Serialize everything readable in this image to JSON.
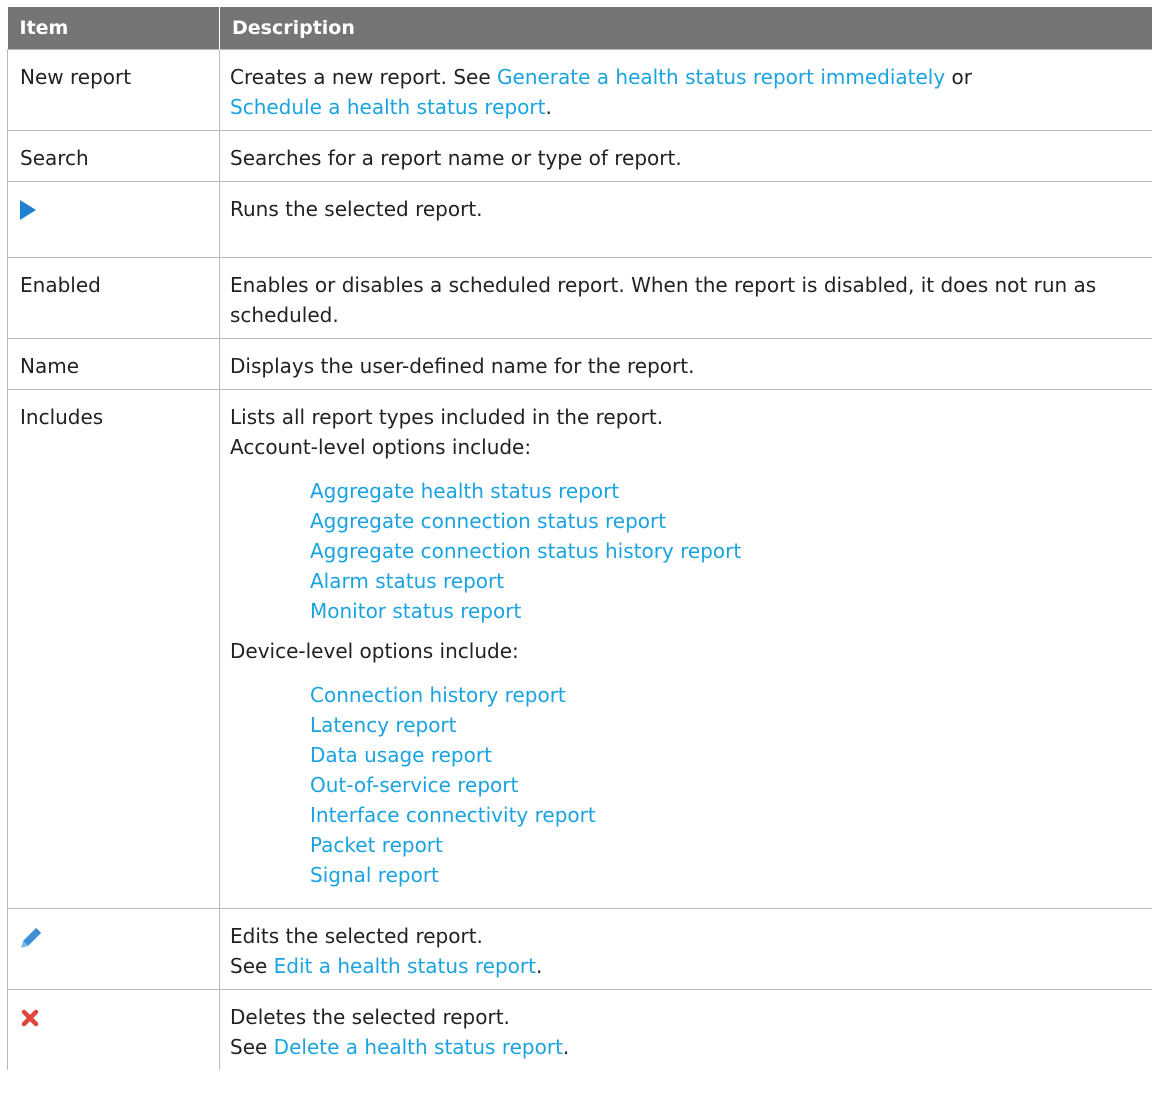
{
  "header": {
    "item": "Item",
    "description": "Description"
  },
  "rows": {
    "new_report": {
      "item": "New report",
      "desc_pre": "Creates a new report. See ",
      "link1": "Generate a health status report immediately",
      "desc_mid": " or",
      "link2": "Schedule a health status report",
      "desc_post": "."
    },
    "search": {
      "item": "Search",
      "desc": "Searches for a report name or type of report."
    },
    "run": {
      "icon": "play-icon",
      "desc": "Runs the selected report."
    },
    "enabled": {
      "item": "Enabled",
      "desc": "Enables or disables a scheduled report. When the report is disabled, it does not run as scheduled."
    },
    "name": {
      "item": "Name",
      "desc": "Displays the user-defined name for the report."
    },
    "includes": {
      "item": "Includes",
      "line1": "Lists all report types included in the report.",
      "line2": "Account-level options include:",
      "account_links": [
        "Aggregate health status report",
        "Aggregate connection status report",
        "Aggregate connection status history report",
        "Alarm status report",
        "Monitor status report"
      ],
      "device_intro": "Device-level options include:",
      "device_links": [
        "Connection history report",
        "Latency report",
        "Data usage report",
        "Out-of-service report",
        "Interface connectivity report",
        "Packet report",
        "Signal report"
      ]
    },
    "edit": {
      "icon": "pencil-icon",
      "line1": "Edits the selected report.",
      "see": "See ",
      "link": "Edit a health status report",
      "post": "."
    },
    "delete": {
      "icon": "close-icon",
      "line1": "Deletes the selected report.",
      "see": "See ",
      "link": "Delete a health status report",
      "post": "."
    }
  },
  "colors": {
    "header_bg": "#757575",
    "link": "#1ba3e0",
    "play_icon": "#1f7fcf",
    "pencil_icon": "#3f8fd8",
    "delete_icon": "#e0443a"
  }
}
